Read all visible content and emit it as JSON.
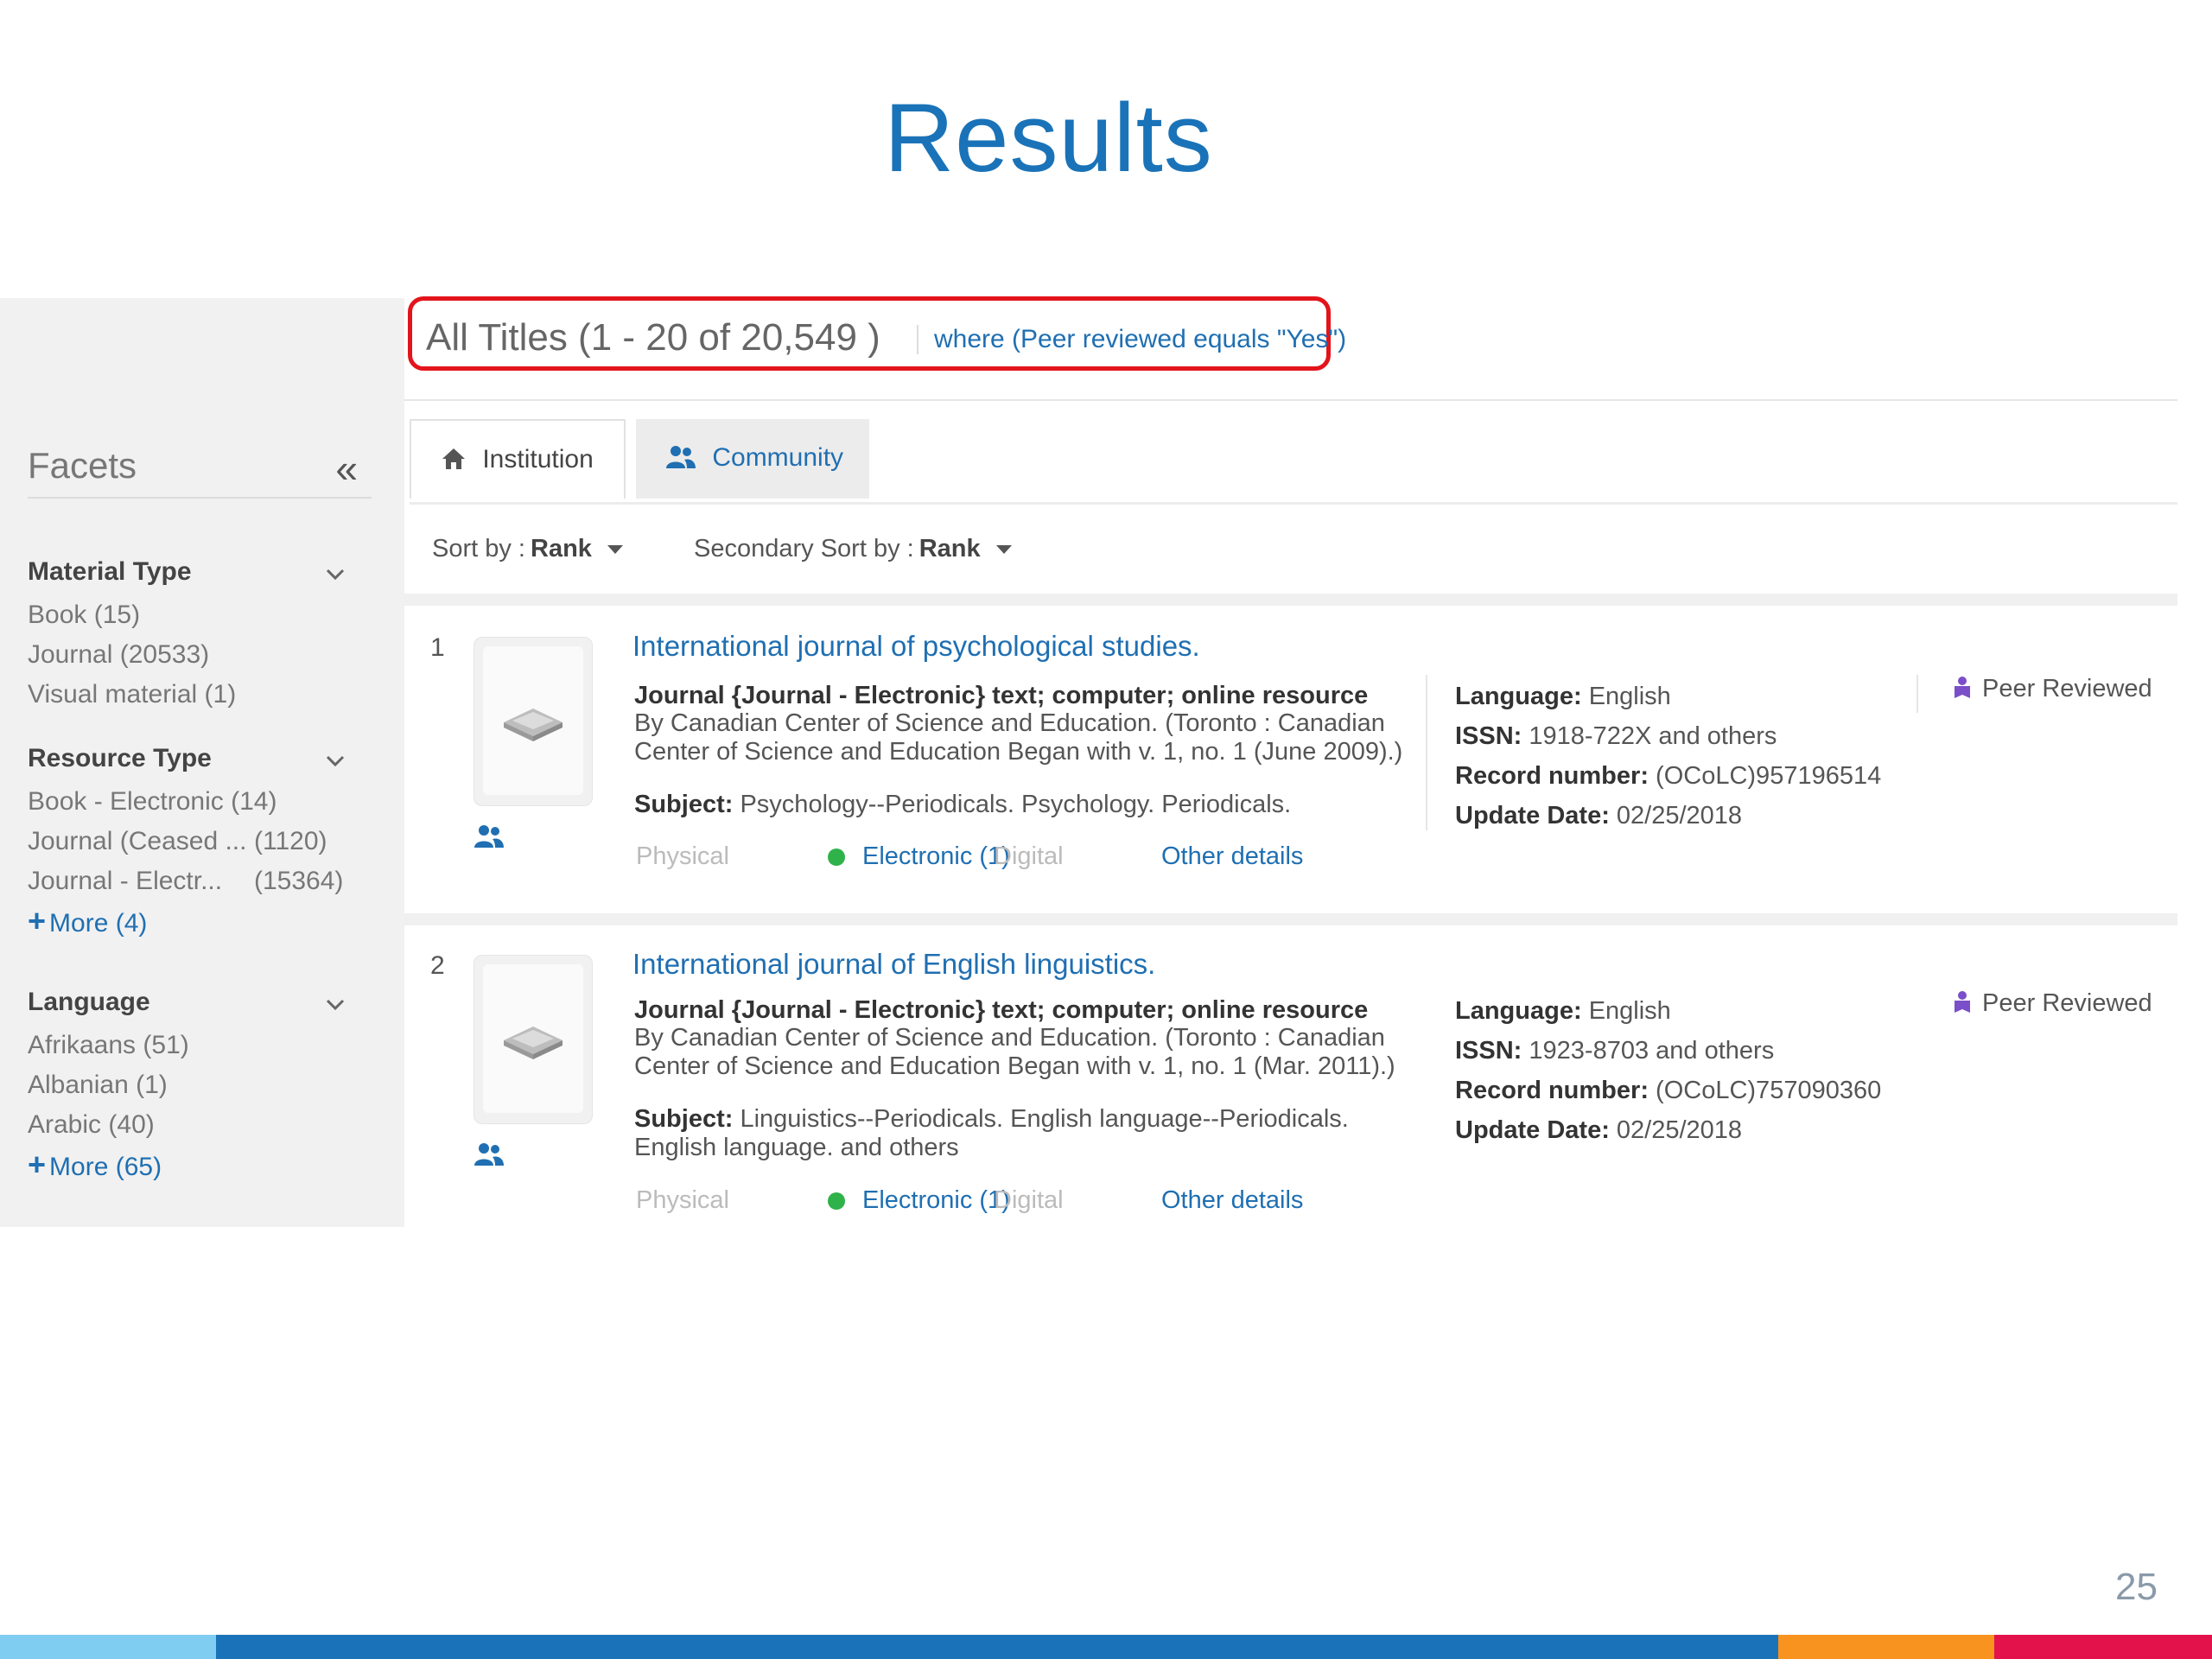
{
  "slide": {
    "title": "Results",
    "page_number": "25"
  },
  "facets": {
    "title": "Facets",
    "groups": [
      {
        "name": "Material Type",
        "items": [
          {
            "label": "Book",
            "count": "(15)"
          },
          {
            "label": "Journal",
            "count": "(20533)"
          },
          {
            "label": "Visual material",
            "count": "(1)"
          }
        ]
      },
      {
        "name": "Resource Type",
        "items": [
          {
            "label": "Book - Electronic",
            "count": "(14)"
          },
          {
            "label": "Journal (Ceased ...",
            "count": "(1120)"
          },
          {
            "label": "Journal - Electr...",
            "count": "(15364)"
          }
        ],
        "more": "More (4)"
      },
      {
        "name": "Language",
        "items": [
          {
            "label": "Afrikaans",
            "count": "(51)"
          },
          {
            "label": "Albanian",
            "count": "(1)"
          },
          {
            "label": "Arabic",
            "count": "(40)"
          }
        ],
        "more": "More (65)"
      }
    ]
  },
  "summary": {
    "title": "All Titles (1 - 20 of 20,549 )",
    "filter": "where (Peer reviewed equals \"Yes\")"
  },
  "tabs": [
    {
      "label": "Institution"
    },
    {
      "label": "Community"
    }
  ],
  "sort": {
    "label": "Sort by :",
    "value": "Rank",
    "secondary_label": "Secondary Sort by :",
    "secondary_value": "Rank"
  },
  "availability_labels": {
    "physical": "Physical",
    "electronic": "Electronic (1)",
    "digital": "Digital",
    "other": "Other details"
  },
  "results": [
    {
      "num": "1",
      "title": "International journal of psychological studies.",
      "type": "Journal {Journal - Electronic} text; computer; online resource",
      "by": "By Canadian Center of Science and Education. (Toronto : Canadian Center of Science and Education Began with v. 1, no. 1 (June 2009).)",
      "subject_label": "Subject:",
      "subject": "Psychology--Periodicals. Psychology. Periodicals.",
      "language": "English",
      "issn": "1918-722X and others",
      "record": "(OCoLC)957196514",
      "update": "02/25/2018",
      "peer": "Peer Reviewed"
    },
    {
      "num": "2",
      "title": "International journal of English linguistics.",
      "type": "Journal {Journal - Electronic} text; computer; online resource",
      "by": "By Canadian Center of Science and Education. (Toronto : Canadian Center of Science and Education Began with v. 1, no. 1 (Mar. 2011).)",
      "subject_label": "Subject:",
      "subject": "Linguistics--Periodicals. English language--Periodicals. English language. and others",
      "language": "English",
      "issn": "1923-8703 and others",
      "record": "(OCoLC)757090360",
      "update": "02/25/2018",
      "peer": "Peer Reviewed"
    }
  ],
  "meta_labels": {
    "language": "Language:",
    "issn": "ISSN:",
    "record": "Record number:",
    "update": "Update Date:"
  },
  "colors": {
    "accent": "#1f6fb2",
    "title": "#1a73b8",
    "highlight": "#e3141b",
    "available": "#2fb24a",
    "footer": [
      "#7fcdf0",
      "#1a73b8",
      "#f7931e",
      "#e3124b"
    ]
  },
  "icons": {
    "collapse": "double-chevron-left-icon",
    "home": "home-icon",
    "community": "users-icon",
    "chevron": "chevron-down-icon",
    "peer": "peer-reviewed-icon"
  }
}
